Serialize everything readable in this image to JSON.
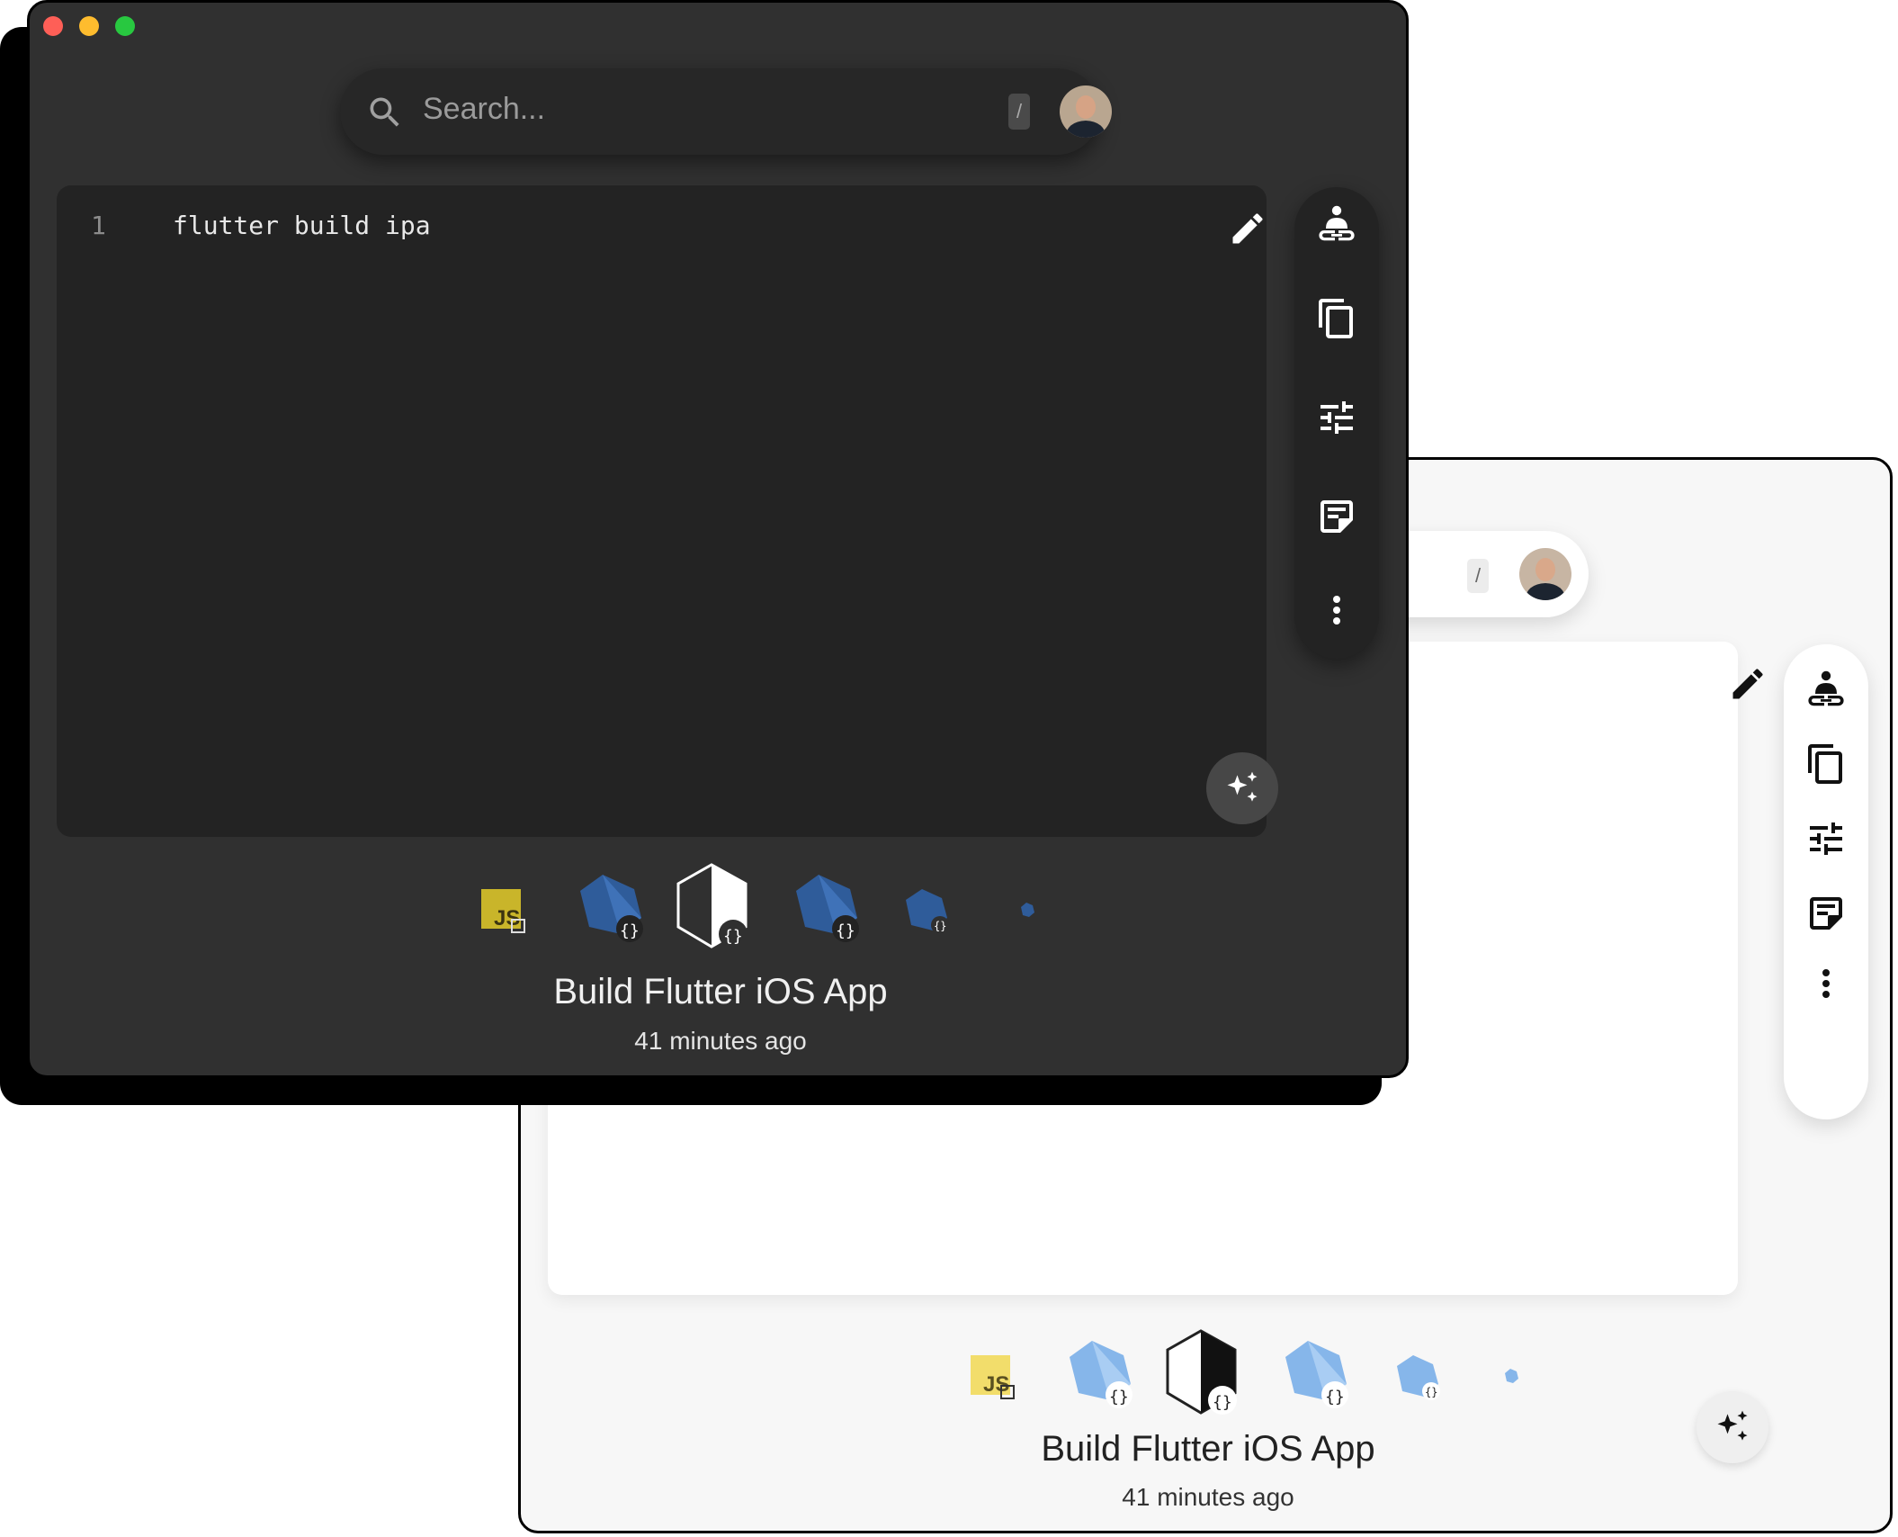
{
  "search": {
    "placeholder": "Search...",
    "shortcut_key": "/"
  },
  "editor": {
    "line_number": "1",
    "code": "flutter build ipa"
  },
  "snippet": {
    "title": "Build Flutter iOS App",
    "updated": "41 minutes ago"
  },
  "toolbar": {
    "icons": [
      "share-user-link-icon",
      "copy-icon",
      "sliders-icon",
      "notes-icon",
      "more-vert-icon"
    ]
  },
  "chips": [
    {
      "name": "javascript-chip",
      "label": "JS",
      "colors": {
        "dark": "#c9b52a",
        "light": "#f2dd6b"
      }
    },
    {
      "name": "dart-chip-1"
    },
    {
      "name": "shell-chip-selected"
    },
    {
      "name": "dart-chip-2"
    },
    {
      "name": "dart-chip-3"
    },
    {
      "name": "dart-chip-4"
    }
  ],
  "colors": {
    "dark_window": "#303030",
    "dark_editor": "#232323",
    "light_window": "#f7f7f7",
    "dart_dark": "#2f5c9a",
    "dart_light": "#86b6ea",
    "close": "#fe5f57",
    "minimize": "#febc2e",
    "zoom": "#28c840"
  }
}
